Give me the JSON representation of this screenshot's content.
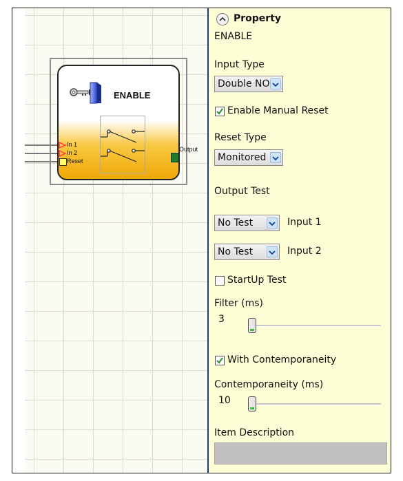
{
  "block": {
    "title": "ENABLE",
    "inputs": [
      "In 1",
      "In 2",
      "Reset"
    ],
    "output": "Output"
  },
  "panel": {
    "header": "Property",
    "subtitle": "ENABLE",
    "input_type_label": "Input Type",
    "input_type_value": "Double NO",
    "enable_manual_reset_label": "Enable Manual Reset",
    "enable_manual_reset_checked": true,
    "reset_type_label": "Reset Type",
    "reset_type_value": "Monitored",
    "output_test_label": "Output Test",
    "output_test_1_value": "No Test",
    "output_test_1_label": "Input 1",
    "output_test_2_value": "No Test",
    "output_test_2_label": "Input 2",
    "startup_test_label": "StartUp Test",
    "startup_test_checked": false,
    "filter_label": "Filter (ms)",
    "filter_value": "3",
    "with_contemporaneity_label": "With Contemporaneity",
    "with_contemporaneity_checked": true,
    "contemporaneity_label": "Contemporaneity (ms)",
    "contemporaneity_value": "10",
    "item_description_label": "Item Description",
    "item_description_value": ""
  },
  "colors": {
    "panel_bg": "#fefed6",
    "divider": "#1c3a78",
    "block_gradient_bottom": "#f0a808",
    "output_pin": "#1f7a2e",
    "reset_pin": "#ffff66",
    "input_arrow": "#ff3b3b",
    "check_mark": "#2e8b2e"
  },
  "icons": [
    "key-switch-icon",
    "collapse-chevron-icon",
    "dropdown-arrow-icon",
    "checkmark-icon"
  ]
}
